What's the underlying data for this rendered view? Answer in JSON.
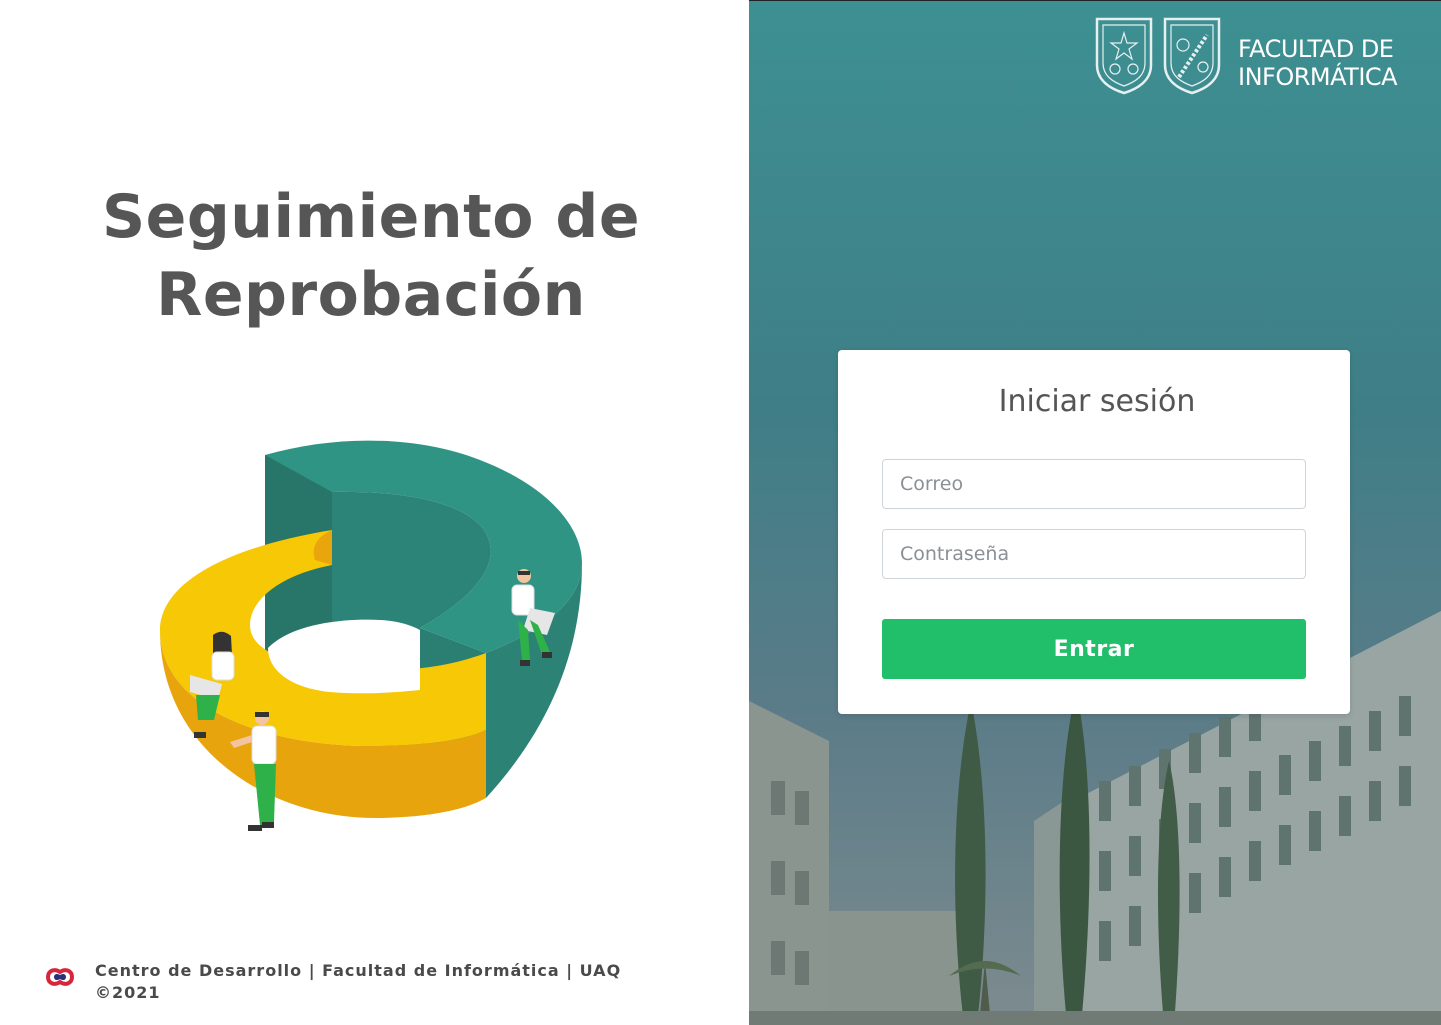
{
  "hero": {
    "title_line1": "Seguimiento de",
    "title_line2": "Reprobación"
  },
  "footer": {
    "line1": "Centro de Desarrollo | Facultad de Informática | UAQ",
    "line2": "©2021",
    "logo_icon": "centro-desarrollo-logo"
  },
  "branding": {
    "line1": "FACULTAD DE",
    "line2": "INFORMÁTICA",
    "seal_icons": [
      "uaq-seal-icon",
      "informatica-seal-icon"
    ]
  },
  "login": {
    "title": "Iniciar sesión",
    "email_placeholder": "Correo",
    "password_placeholder": "Contraseña",
    "submit_label": "Entrar"
  },
  "colors": {
    "button": "#22bf6b",
    "teal": "#2e8f82",
    "yellow": "#f5c805",
    "title_text": "#565656"
  }
}
